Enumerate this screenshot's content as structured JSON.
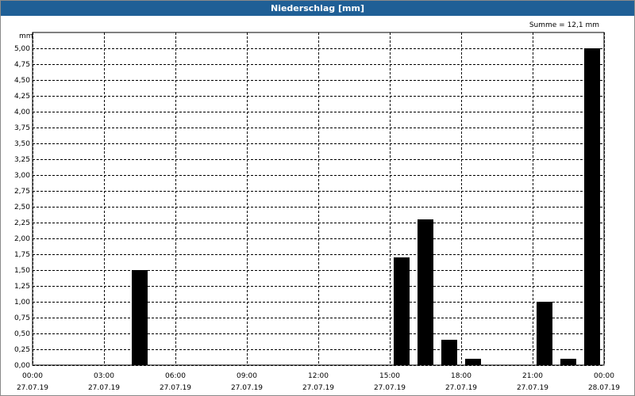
{
  "window": {
    "title": "Niederschlag [mm]"
  },
  "chart_data": {
    "type": "bar",
    "title": "Niederschlag [mm]",
    "ylabel": "mm",
    "ylim": [
      0,
      5
    ],
    "annotation": "Summe = 12,1 mm",
    "y_ticks": [
      "0,00",
      "0,25",
      "0,50",
      "0,75",
      "1,00",
      "1,25",
      "1,50",
      "1,75",
      "2,00",
      "2,25",
      "2,50",
      "2,75",
      "3,00",
      "3,25",
      "3,50",
      "3,75",
      "4,00",
      "4,25",
      "4,50",
      "4,75",
      "5,00"
    ],
    "x_ticks": [
      {
        "time": "00:00",
        "date": "27.07.19"
      },
      {
        "time": "03:00",
        "date": "27.07.19"
      },
      {
        "time": "06:00",
        "date": "27.07.19"
      },
      {
        "time": "09:00",
        "date": "27.07.19"
      },
      {
        "time": "12:00",
        "date": "27.07.19"
      },
      {
        "time": "15:00",
        "date": "27.07.19"
      },
      {
        "time": "18:00",
        "date": "27.07.19"
      },
      {
        "time": "21:00",
        "date": "27.07.19"
      },
      {
        "time": "00:00",
        "date": "28.07.19"
      }
    ],
    "bars": [
      {
        "hour": 4.5,
        "value": 1.5
      },
      {
        "hour": 15.5,
        "value": 1.7
      },
      {
        "hour": 16.5,
        "value": 2.3
      },
      {
        "hour": 17.5,
        "value": 0.4
      },
      {
        "hour": 18.5,
        "value": 0.1
      },
      {
        "hour": 21.5,
        "value": 1.0
      },
      {
        "hour": 22.5,
        "value": 0.1
      },
      {
        "hour": 23.5,
        "value": 5.0
      }
    ],
    "grid": true,
    "bar_color": "#000000"
  }
}
